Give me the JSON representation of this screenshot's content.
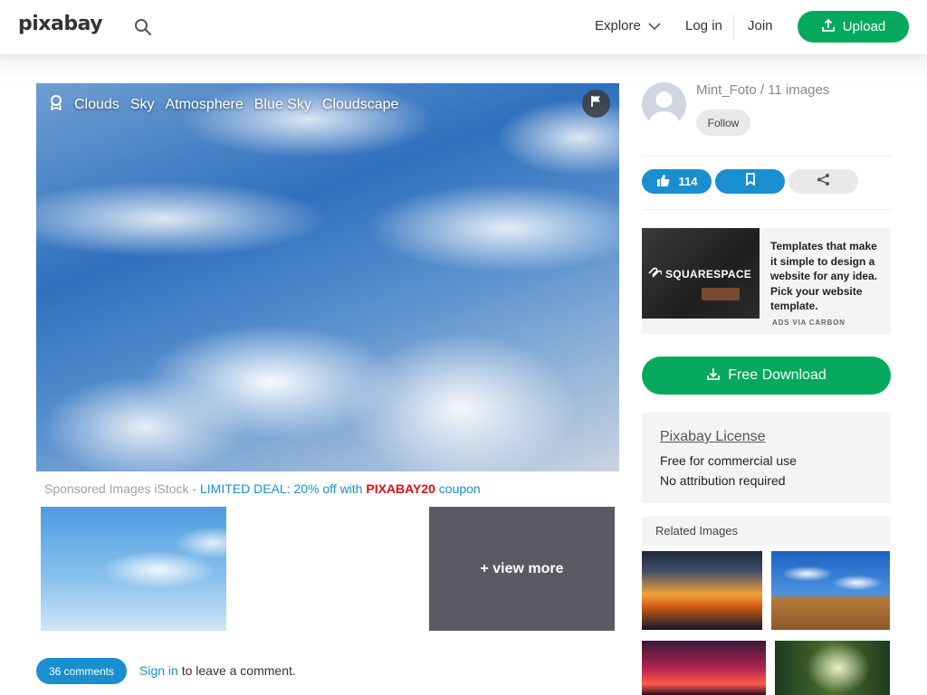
{
  "header": {
    "logo": "pixabay",
    "nav": {
      "explore": "Explore",
      "login": "Log in",
      "join": "Join"
    },
    "upload_label": "Upload"
  },
  "photo": {
    "tags": [
      "Clouds",
      "Sky",
      "Atmosphere",
      "Blue Sky",
      "Cloudscape"
    ]
  },
  "sponsored": {
    "prefix": "Sponsored Images iStock - ",
    "deal": "LIMITED DEAL: 20% off with ",
    "code": "PIXABAY20",
    "suffix": " coupon",
    "view_more": "+ view more"
  },
  "comments": {
    "count_label": "36 comments",
    "signin_link": "Sign in",
    "signin_text": " to leave a comment."
  },
  "author": {
    "name_line": "Mint_Foto / 11 images",
    "follow_label": "Follow"
  },
  "actions": {
    "likes": "114"
  },
  "ad": {
    "brand": "SQUARESPACE",
    "text": "Templates that make it simple to design a website for any idea. Pick your website template.",
    "via": "ADS VIA CARBON"
  },
  "download_label": "Free Download",
  "license": {
    "title": "Pixabay License",
    "line1": "Free for commercial use",
    "line2": "No attribution required"
  },
  "related": {
    "title": "Related Images"
  },
  "colors": {
    "green": "#04a95e",
    "blue": "#1a8fd0",
    "coupon_red": "#e01010"
  }
}
